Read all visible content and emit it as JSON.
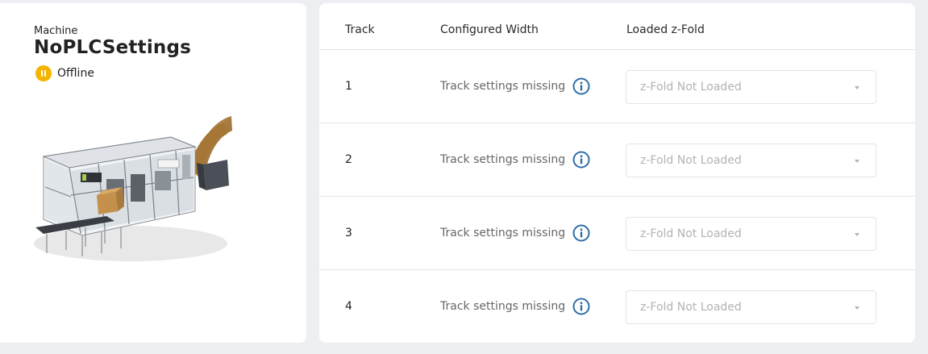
{
  "machine": {
    "label": "Machine",
    "name": "NoPLCSettings",
    "status": "Offline",
    "status_color": "#f4b400"
  },
  "table": {
    "headers": {
      "track": "Track",
      "configured_width": "Configured Width",
      "loaded_zfold": "Loaded z-Fold"
    },
    "rows": [
      {
        "track": "1",
        "width_status": "Track settings missing",
        "zfold_value": "z-Fold Not Loaded"
      },
      {
        "track": "2",
        "width_status": "Track settings missing",
        "zfold_value": "z-Fold Not Loaded"
      },
      {
        "track": "3",
        "width_status": "Track settings missing",
        "zfold_value": "z-Fold Not Loaded"
      },
      {
        "track": "4",
        "width_status": "Track settings missing",
        "zfold_value": "z-Fold Not Loaded"
      }
    ]
  },
  "icons": {
    "info": "info-circle-icon",
    "dropdown": "chevron-down-icon",
    "status": "pause-icon"
  },
  "colors": {
    "info_icon": "#2f6ea8",
    "placeholder_text": "#b3b3b3"
  }
}
